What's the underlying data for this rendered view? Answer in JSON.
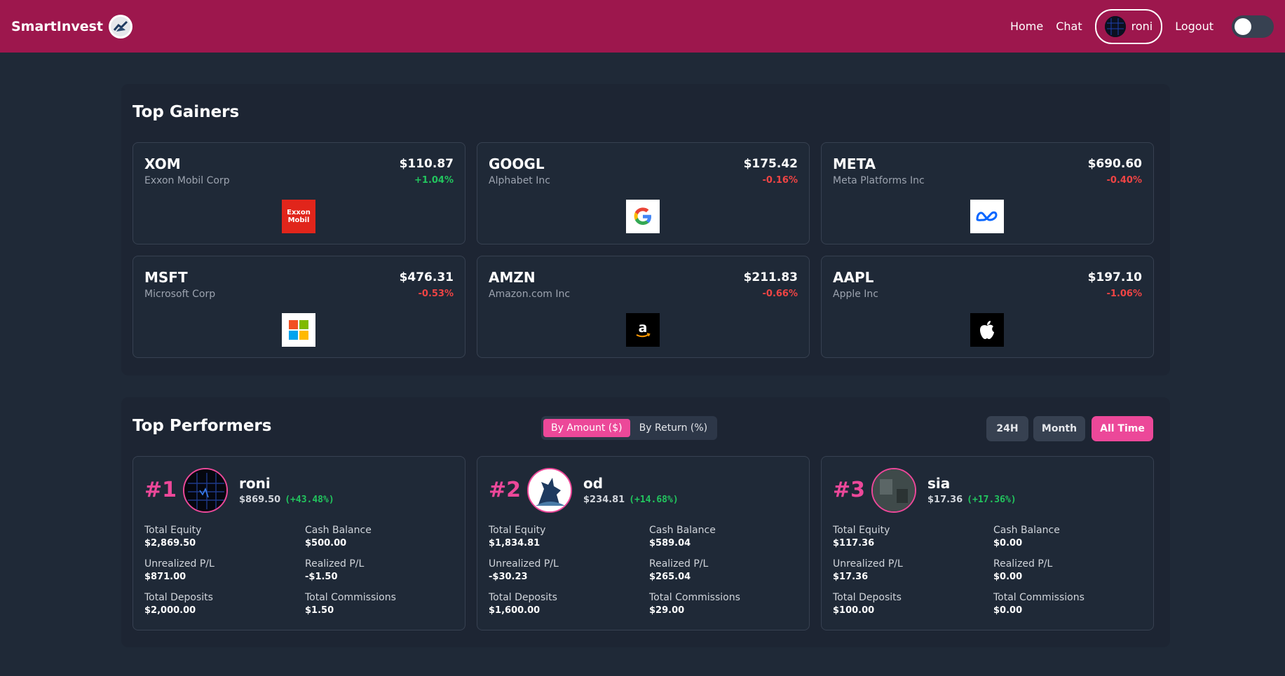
{
  "nav": {
    "brand": "SmartInvest",
    "links": [
      "Home",
      "Chat"
    ],
    "user": "roni",
    "logout": "Logout",
    "theme_toggle_on": false
  },
  "gainers": {
    "title": "Top Gainers",
    "cards": [
      {
        "symbol": "XOM",
        "name": "Exxon Mobil Corp",
        "price": "$110.87",
        "change": "+1.04%",
        "logo": "exxon-mobil-logo"
      },
      {
        "symbol": "GOOGL",
        "name": "Alphabet Inc",
        "price": "$175.42",
        "change": "-0.16%",
        "logo": "google-logo"
      },
      {
        "symbol": "META",
        "name": "Meta Platforms Inc",
        "price": "$690.60",
        "change": "-0.40%",
        "logo": "meta-logo"
      },
      {
        "symbol": "MSFT",
        "name": "Microsoft Corp",
        "price": "$476.31",
        "change": "-0.53%",
        "logo": "microsoft-logo"
      },
      {
        "symbol": "AMZN",
        "name": "Amazon.com Inc",
        "price": "$211.83",
        "change": "-0.66%",
        "logo": "amazon-logo"
      },
      {
        "symbol": "AAPL",
        "name": "Apple Inc",
        "price": "$197.10",
        "change": "-1.06%",
        "logo": "apple-logo"
      }
    ],
    "exxon_logo_text": [
      "Exxon",
      "Mobil"
    ]
  },
  "performers": {
    "title": "Top Performers",
    "sort_options": [
      "By Amount ($)",
      "By Return (%)"
    ],
    "sort_selected": "By Amount ($)",
    "periods": [
      "24H",
      "Month",
      "All Time"
    ],
    "period_selected": "All Time",
    "labels": {
      "total_equity": "Total Equity",
      "cash_balance": "Cash Balance",
      "unrealized": "Unrealized P/L",
      "realized": "Realized P/L",
      "deposits": "Total Deposits",
      "commissions": "Total Commissions"
    },
    "cards": [
      {
        "rank": "#1",
        "name": "roni",
        "amount": "$869.50",
        "return": "(+43.48%)",
        "total_equity": "$2,869.50",
        "cash_balance": "$500.00",
        "unrealized": "$871.00",
        "realized": "-$1.50",
        "deposits": "$2,000.00",
        "commissions": "$1.50"
      },
      {
        "rank": "#2",
        "name": "od",
        "amount": "$234.81",
        "return": "(+14.68%)",
        "total_equity": "$1,834.81",
        "cash_balance": "$589.04",
        "unrealized": "-$30.23",
        "realized": "$265.04",
        "deposits": "$1,600.00",
        "commissions": "$29.00"
      },
      {
        "rank": "#3",
        "name": "sia",
        "amount": "$17.36",
        "return": "(+17.36%)",
        "total_equity": "$117.36",
        "cash_balance": "$0.00",
        "unrealized": "$17.36",
        "realized": "$0.00",
        "deposits": "$100.00",
        "commissions": "$0.00"
      }
    ]
  },
  "colors": {
    "nav": "#9d174d",
    "accent": "#ec4899",
    "positive": "#22c55e",
    "negative": "#ef4444",
    "background": "#1f2937"
  }
}
